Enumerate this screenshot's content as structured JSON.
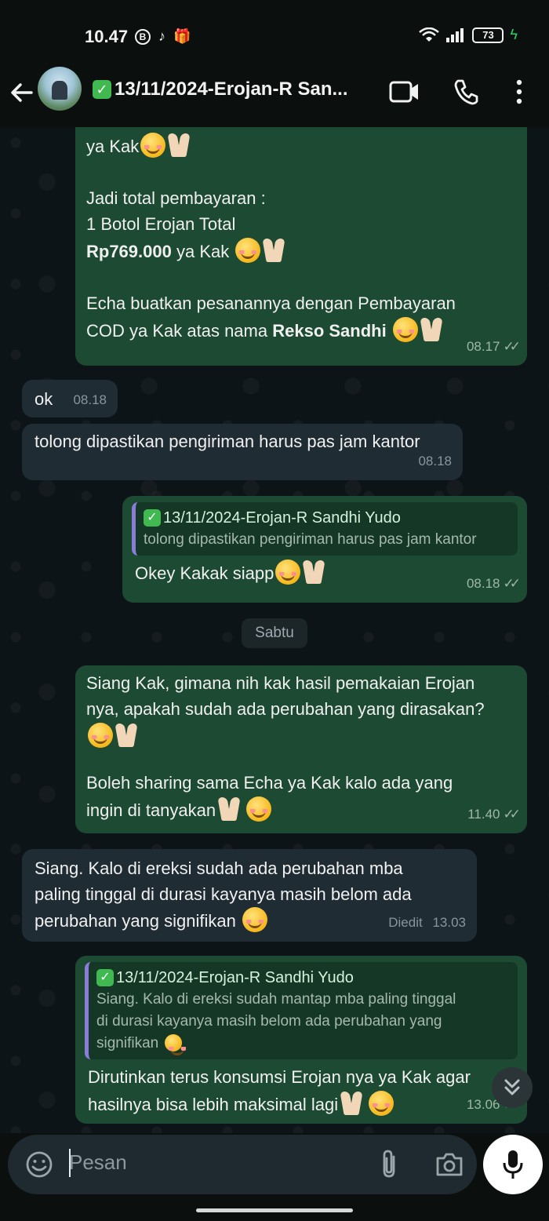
{
  "status_bar": {
    "time": "10.47",
    "icons": [
      "B",
      "tiktok-icon",
      "gift-icon"
    ],
    "battery": "73"
  },
  "header": {
    "title": "13/11/2024-Erojan-R San...",
    "icons": [
      "back-arrow-icon",
      "video-call-icon",
      "phone-icon",
      "more-icon"
    ]
  },
  "messages": {
    "m1": {
      "line1": "ya Kak",
      "line2": "Jadi total pembayaran :",
      "line3": "1 Botol Erojan Total",
      "line4_bold": "Rp769.000",
      "line4_rest": " ya Kak ",
      "line5": "Echa buatkan pesanannya dengan Pembayaran",
      "line6_pre": "COD ya Kak atas nama ",
      "line6_bold": "Rekso Sandhi",
      "time": "08.17"
    },
    "m2": {
      "text": "ok",
      "time": "08.18"
    },
    "m3": {
      "text": "tolong dipastikan pengiriman harus pas jam kantor",
      "time": "08.18"
    },
    "m4": {
      "quote_name": "13/11/2024-Erojan-R Sandhi Yudo",
      "quote_text": "tolong dipastikan pengiriman harus pas jam kantor",
      "text": "Okey Kakak siapp",
      "time": "08.18"
    },
    "date_chip": "Sabtu",
    "m5": {
      "line1": "Siang Kak, gimana nih kak hasil pemakaian Erojan",
      "line2": "nya, apakah sudah ada perubahan yang dirasakan?",
      "line3": "Boleh sharing sama Echa ya Kak kalo ada yang",
      "line4": "ingin di tanyakan",
      "time": "11.40"
    },
    "m6": {
      "line1": "Siang. Kalo di ereksi sudah ada perubahan mba",
      "line2": "paling tinggal di durasi kayanya masih belom ada",
      "line3": "perubahan yang signifikan",
      "edited": "Diedit",
      "time": "13.03"
    },
    "m7": {
      "quote_name": "13/11/2024-Erojan-R Sandhi Yudo",
      "quote_line1": "Siang. Kalo di ereksi sudah mantap mba paling tinggal",
      "quote_line2": "di durasi kayanya masih belom ada perubahan yang",
      "quote_line3": "signifikan",
      "line1": "Dirutinkan terus konsumsi Erojan nya ya Kak agar",
      "line2": "hasilnya bisa lebih maksimal lagi",
      "time": "13.06"
    }
  },
  "input": {
    "placeholder": "Pesan",
    "icons": [
      "emoji-icon",
      "attach-icon",
      "camera-icon",
      "mic-icon"
    ]
  },
  "colors": {
    "outgoing_bubble": "#1d4a33",
    "incoming_bubble": "#202c33",
    "background": "#0d1418",
    "quote_bar": "#8a7cd8"
  }
}
